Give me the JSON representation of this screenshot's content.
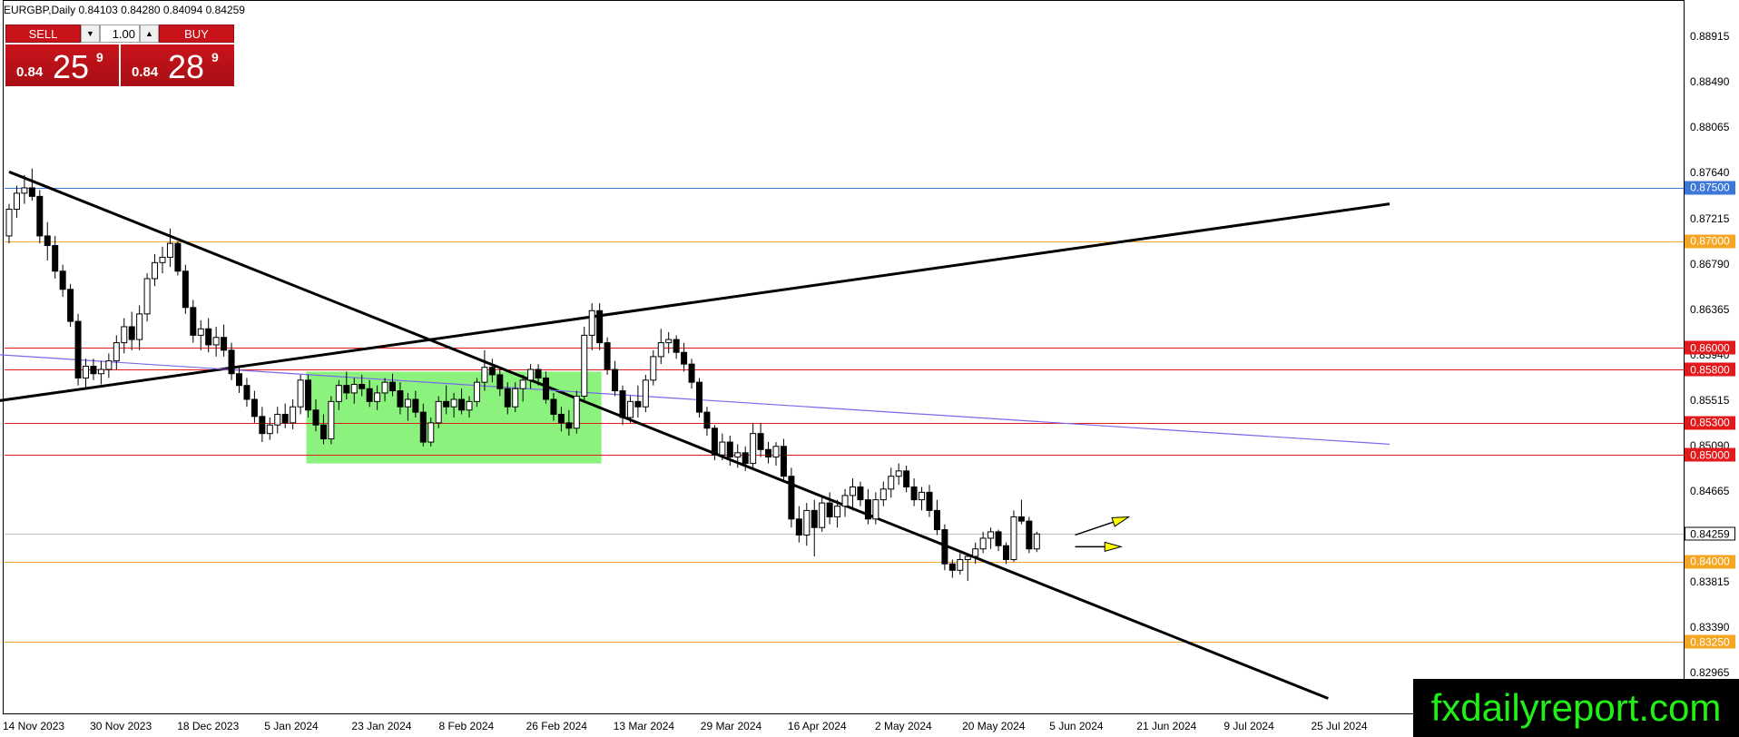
{
  "header": {
    "symbol_line": "EURGBP,Daily  0.84103 0.84280 0.84094 0.84259"
  },
  "trade_panel": {
    "sell_label": "SELL",
    "buy_label": "BUY",
    "lot_value": "1.00",
    "sell_price": {
      "small": "0.84",
      "big": "25",
      "sup": "9"
    },
    "buy_price": {
      "small": "0.84",
      "big": "28",
      "sup": "9"
    }
  },
  "watermark": "fxdailyreport.com",
  "colors": {
    "candle_up": "#ffffff",
    "candle_down": "#000000",
    "red_line": "#e31a1c",
    "orange_line": "#f5a623",
    "blue_line": "#3b78d8",
    "purple_line": "#7b68ee",
    "trend_line": "#000000",
    "box_fill": "#8cf27e",
    "arrow_fill": "#ffff00"
  },
  "chart_data": {
    "type": "candlestick",
    "symbol": "EURGBP",
    "timeframe": "Daily",
    "ohlc_header": {
      "open": 0.84103,
      "high": 0.8428,
      "low": 0.84094,
      "close": 0.84259
    },
    "ylim": [
      0.8258,
      0.8925
    ],
    "y_ticks": [
      "0.88915",
      "0.88490",
      "0.88065",
      "0.87640",
      "0.87215",
      "0.86790",
      "0.86365",
      "0.85940",
      "0.85515",
      "0.85090",
      "0.84665",
      "0.84240",
      "0.83815",
      "0.83390",
      "0.82965"
    ],
    "x_tick_labels": [
      "14 Nov 2023",
      "30 Nov 2023",
      "18 Dec 2023",
      "5 Jan 2024",
      "23 Jan 2024",
      "8 Feb 2024",
      "26 Feb 2024",
      "13 Mar 2024",
      "29 Mar 2024",
      "16 Apr 2024",
      "2 May 2024",
      "20 May 2024",
      "5 Jun 2024",
      "21 Jun 2024",
      "9 Jul 2024",
      "25 Jul 2024"
    ],
    "current_price": "0.84259",
    "horizontal_levels": [
      {
        "label": "0.87500",
        "value": 0.875,
        "color": "blue"
      },
      {
        "label": "0.87000",
        "value": 0.87,
        "color": "orange"
      },
      {
        "label": "0.86000",
        "value": 0.86,
        "color": "red"
      },
      {
        "label": "0.85800",
        "value": 0.858,
        "color": "red"
      },
      {
        "label": "0.85300",
        "value": 0.853,
        "color": "red"
      },
      {
        "label": "0.85000",
        "value": 0.85,
        "color": "red"
      },
      {
        "label": "0.84000",
        "value": 0.84,
        "color": "orange"
      },
      {
        "label": "0.83250",
        "value": 0.8325,
        "color": "orange"
      }
    ],
    "candles": [
      [
        0.8705,
        0.8735,
        0.8698,
        0.873
      ],
      [
        0.873,
        0.8752,
        0.8722,
        0.8745
      ],
      [
        0.8745,
        0.8762,
        0.8735,
        0.875
      ],
      [
        0.875,
        0.8768,
        0.8738,
        0.8742
      ],
      [
        0.8742,
        0.8748,
        0.8698,
        0.8705
      ],
      [
        0.8705,
        0.8718,
        0.8682,
        0.8696
      ],
      [
        0.8696,
        0.8705,
        0.8665,
        0.8672
      ],
      [
        0.8672,
        0.8678,
        0.8648,
        0.8655
      ],
      [
        0.8655,
        0.866,
        0.862,
        0.8625
      ],
      [
        0.8625,
        0.8632,
        0.8565,
        0.8572
      ],
      [
        0.8572,
        0.859,
        0.8562,
        0.8583
      ],
      [
        0.8583,
        0.859,
        0.857,
        0.8576
      ],
      [
        0.8576,
        0.8588,
        0.8566,
        0.858
      ],
      [
        0.858,
        0.8595,
        0.8572,
        0.8588
      ],
      [
        0.8588,
        0.8612,
        0.858,
        0.8605
      ],
      [
        0.8605,
        0.8628,
        0.8595,
        0.862
      ],
      [
        0.862,
        0.8634,
        0.8598,
        0.8608
      ],
      [
        0.8608,
        0.864,
        0.8598,
        0.8632
      ],
      [
        0.8632,
        0.867,
        0.8625,
        0.8665
      ],
      [
        0.8665,
        0.8688,
        0.8658,
        0.868
      ],
      [
        0.868,
        0.8695,
        0.867,
        0.8685
      ],
      [
        0.8685,
        0.8712,
        0.8676,
        0.8698
      ],
      [
        0.8698,
        0.87,
        0.8668,
        0.8672
      ],
      [
        0.8672,
        0.8678,
        0.8632,
        0.8638
      ],
      [
        0.8638,
        0.8645,
        0.8605,
        0.8612
      ],
      [
        0.8612,
        0.8626,
        0.8598,
        0.8618
      ],
      [
        0.8618,
        0.8628,
        0.8596,
        0.8603
      ],
      [
        0.8603,
        0.862,
        0.8592,
        0.861
      ],
      [
        0.861,
        0.8622,
        0.8592,
        0.8598
      ],
      [
        0.8598,
        0.8605,
        0.857,
        0.8576
      ],
      [
        0.8576,
        0.8582,
        0.8558,
        0.8565
      ],
      [
        0.8565,
        0.8572,
        0.8545,
        0.8552
      ],
      [
        0.8552,
        0.856,
        0.853,
        0.8536
      ],
      [
        0.8536,
        0.8545,
        0.8512,
        0.852
      ],
      [
        0.852,
        0.8535,
        0.8514,
        0.8528
      ],
      [
        0.8528,
        0.8545,
        0.852,
        0.8538
      ],
      [
        0.8538,
        0.8548,
        0.8525,
        0.853
      ],
      [
        0.853,
        0.8552,
        0.8524,
        0.8545
      ],
      [
        0.8545,
        0.8575,
        0.8538,
        0.857
      ],
      [
        0.857,
        0.8575,
        0.8535,
        0.8542
      ],
      [
        0.8542,
        0.8552,
        0.8522,
        0.8528
      ],
      [
        0.8528,
        0.8538,
        0.851,
        0.8515
      ],
      [
        0.8515,
        0.8555,
        0.851,
        0.855
      ],
      [
        0.855,
        0.857,
        0.8542,
        0.8565
      ],
      [
        0.8565,
        0.8578,
        0.8552,
        0.8558
      ],
      [
        0.8558,
        0.8572,
        0.8548,
        0.8566
      ],
      [
        0.8566,
        0.8575,
        0.8555,
        0.8562
      ],
      [
        0.8562,
        0.857,
        0.8545,
        0.855
      ],
      [
        0.855,
        0.8565,
        0.8542,
        0.8558
      ],
      [
        0.8558,
        0.8572,
        0.855,
        0.8568
      ],
      [
        0.8568,
        0.8576,
        0.8555,
        0.856
      ],
      [
        0.856,
        0.8568,
        0.8538,
        0.8545
      ],
      [
        0.8545,
        0.8558,
        0.8532,
        0.8552
      ],
      [
        0.8552,
        0.856,
        0.8535,
        0.854
      ],
      [
        0.854,
        0.8548,
        0.8508,
        0.8512
      ],
      [
        0.8512,
        0.8535,
        0.8508,
        0.853
      ],
      [
        0.853,
        0.8555,
        0.8525,
        0.855
      ],
      [
        0.855,
        0.8565,
        0.8538,
        0.8545
      ],
      [
        0.8545,
        0.8558,
        0.8535,
        0.8552
      ],
      [
        0.8552,
        0.8562,
        0.8538,
        0.8542
      ],
      [
        0.8542,
        0.8555,
        0.8535,
        0.855
      ],
      [
        0.855,
        0.8572,
        0.8545,
        0.8568
      ],
      [
        0.8568,
        0.8598,
        0.856,
        0.8582
      ],
      [
        0.8582,
        0.859,
        0.8568,
        0.8575
      ],
      [
        0.8575,
        0.858,
        0.8555,
        0.8562
      ],
      [
        0.8562,
        0.8568,
        0.8538,
        0.8545
      ],
      [
        0.8545,
        0.8568,
        0.854,
        0.8562
      ],
      [
        0.8562,
        0.8575,
        0.855,
        0.857
      ],
      [
        0.857,
        0.8585,
        0.8562,
        0.858
      ],
      [
        0.858,
        0.8585,
        0.8565,
        0.8572
      ],
      [
        0.8572,
        0.8578,
        0.8548,
        0.8552
      ],
      [
        0.8552,
        0.8558,
        0.8532,
        0.8538
      ],
      [
        0.8538,
        0.8545,
        0.8522,
        0.853
      ],
      [
        0.853,
        0.8542,
        0.8518,
        0.8525
      ],
      [
        0.8525,
        0.856,
        0.852,
        0.8555
      ],
      [
        0.8555,
        0.862,
        0.855,
        0.8612
      ],
      [
        0.8612,
        0.8642,
        0.8598,
        0.8635
      ],
      [
        0.8635,
        0.8642,
        0.8598,
        0.8605
      ],
      [
        0.8605,
        0.861,
        0.8575,
        0.858
      ],
      [
        0.858,
        0.8588,
        0.8555,
        0.856
      ],
      [
        0.856,
        0.8565,
        0.8528,
        0.8535
      ],
      [
        0.8535,
        0.8555,
        0.853,
        0.855
      ],
      [
        0.855,
        0.8565,
        0.8535,
        0.8545
      ],
      [
        0.8545,
        0.8575,
        0.854,
        0.857
      ],
      [
        0.857,
        0.8598,
        0.8565,
        0.8592
      ],
      [
        0.8592,
        0.8618,
        0.8585,
        0.8605
      ],
      [
        0.8605,
        0.8615,
        0.8595,
        0.8608
      ],
      [
        0.8608,
        0.8612,
        0.859,
        0.8596
      ],
      [
        0.8596,
        0.8605,
        0.8578,
        0.8585
      ],
      [
        0.8585,
        0.859,
        0.8562,
        0.8568
      ],
      [
        0.8568,
        0.8572,
        0.8535,
        0.854
      ],
      [
        0.854,
        0.8545,
        0.8518,
        0.8525
      ],
      [
        0.8525,
        0.8528,
        0.8495,
        0.85
      ],
      [
        0.85,
        0.852,
        0.8495,
        0.8512
      ],
      [
        0.8512,
        0.8518,
        0.849,
        0.8498
      ],
      [
        0.8498,
        0.851,
        0.8488,
        0.8502
      ],
      [
        0.8502,
        0.8508,
        0.8485,
        0.8492
      ],
      [
        0.8492,
        0.853,
        0.8488,
        0.852
      ],
      [
        0.852,
        0.853,
        0.8498,
        0.8505
      ],
      [
        0.8505,
        0.8512,
        0.8492,
        0.8498
      ],
      [
        0.8498,
        0.8512,
        0.849,
        0.8508
      ],
      [
        0.8508,
        0.8515,
        0.8475,
        0.848
      ],
      [
        0.848,
        0.8488,
        0.8432,
        0.844
      ],
      [
        0.844,
        0.8452,
        0.8418,
        0.8425
      ],
      [
        0.8425,
        0.8455,
        0.8415,
        0.8448
      ],
      [
        0.8448,
        0.8458,
        0.8405,
        0.8432
      ],
      [
        0.8432,
        0.8462,
        0.8428,
        0.8455
      ],
      [
        0.8455,
        0.8465,
        0.8435,
        0.8442
      ],
      [
        0.8442,
        0.8458,
        0.8432,
        0.8452
      ],
      [
        0.8452,
        0.8468,
        0.8442,
        0.8462
      ],
      [
        0.8462,
        0.8478,
        0.8448,
        0.847
      ],
      [
        0.847,
        0.8475,
        0.8452,
        0.8458
      ],
      [
        0.8458,
        0.8468,
        0.8435,
        0.844
      ],
      [
        0.844,
        0.8465,
        0.8435,
        0.8458
      ],
      [
        0.8458,
        0.8475,
        0.8452,
        0.8468
      ],
      [
        0.8468,
        0.8488,
        0.846,
        0.848
      ],
      [
        0.848,
        0.8492,
        0.8472,
        0.8485
      ],
      [
        0.8485,
        0.849,
        0.8465,
        0.847
      ],
      [
        0.847,
        0.8478,
        0.8452,
        0.8458
      ],
      [
        0.8458,
        0.847,
        0.8448,
        0.8465
      ],
      [
        0.8465,
        0.8472,
        0.8442,
        0.8448
      ],
      [
        0.8448,
        0.8458,
        0.8425,
        0.843
      ],
      [
        0.843,
        0.8435,
        0.8392,
        0.8398
      ],
      [
        0.8398,
        0.8402,
        0.8385,
        0.8392
      ],
      [
        0.8392,
        0.8408,
        0.8388,
        0.8402
      ],
      [
        0.8402,
        0.8408,
        0.8382,
        0.8405
      ],
      [
        0.8405,
        0.8418,
        0.8398,
        0.8412
      ],
      [
        0.8412,
        0.8428,
        0.8408,
        0.8422
      ],
      [
        0.8422,
        0.8432,
        0.8412,
        0.8428
      ],
      [
        0.8428,
        0.843,
        0.841,
        0.8415
      ],
      [
        0.8415,
        0.8418,
        0.8398,
        0.8402
      ],
      [
        0.8402,
        0.8448,
        0.84,
        0.8442
      ],
      [
        0.8442,
        0.8458,
        0.8435,
        0.8438
      ],
      [
        0.8438,
        0.8442,
        0.8408,
        0.8412
      ],
      [
        0.8412,
        0.8428,
        0.8409,
        0.8426
      ]
    ],
    "trend_lines": [
      {
        "from": [
          0,
          0.8765
        ],
        "to": [
          172,
          0.8272
        ],
        "name": "falling-trendline"
      },
      {
        "from": [
          -4,
          0.8548
        ],
        "to": [
          180,
          0.8735
        ],
        "name": "rising-trendline"
      },
      {
        "from": [
          -4,
          0.8595
        ],
        "to": [
          180,
          0.851
        ],
        "name": "moving-average-line"
      }
    ],
    "consolidation_zone": {
      "from_index": 39,
      "to_index": 77,
      "low": 0.8492,
      "high": 0.8578
    },
    "arrows": [
      {
        "name": "up-arrow",
        "from": [
          139,
          0.8425
        ],
        "to": [
          146,
          0.8442
        ]
      },
      {
        "name": "flat-arrow",
        "from": [
          139,
          0.8414
        ],
        "to": [
          145,
          0.8414
        ]
      }
    ]
  }
}
